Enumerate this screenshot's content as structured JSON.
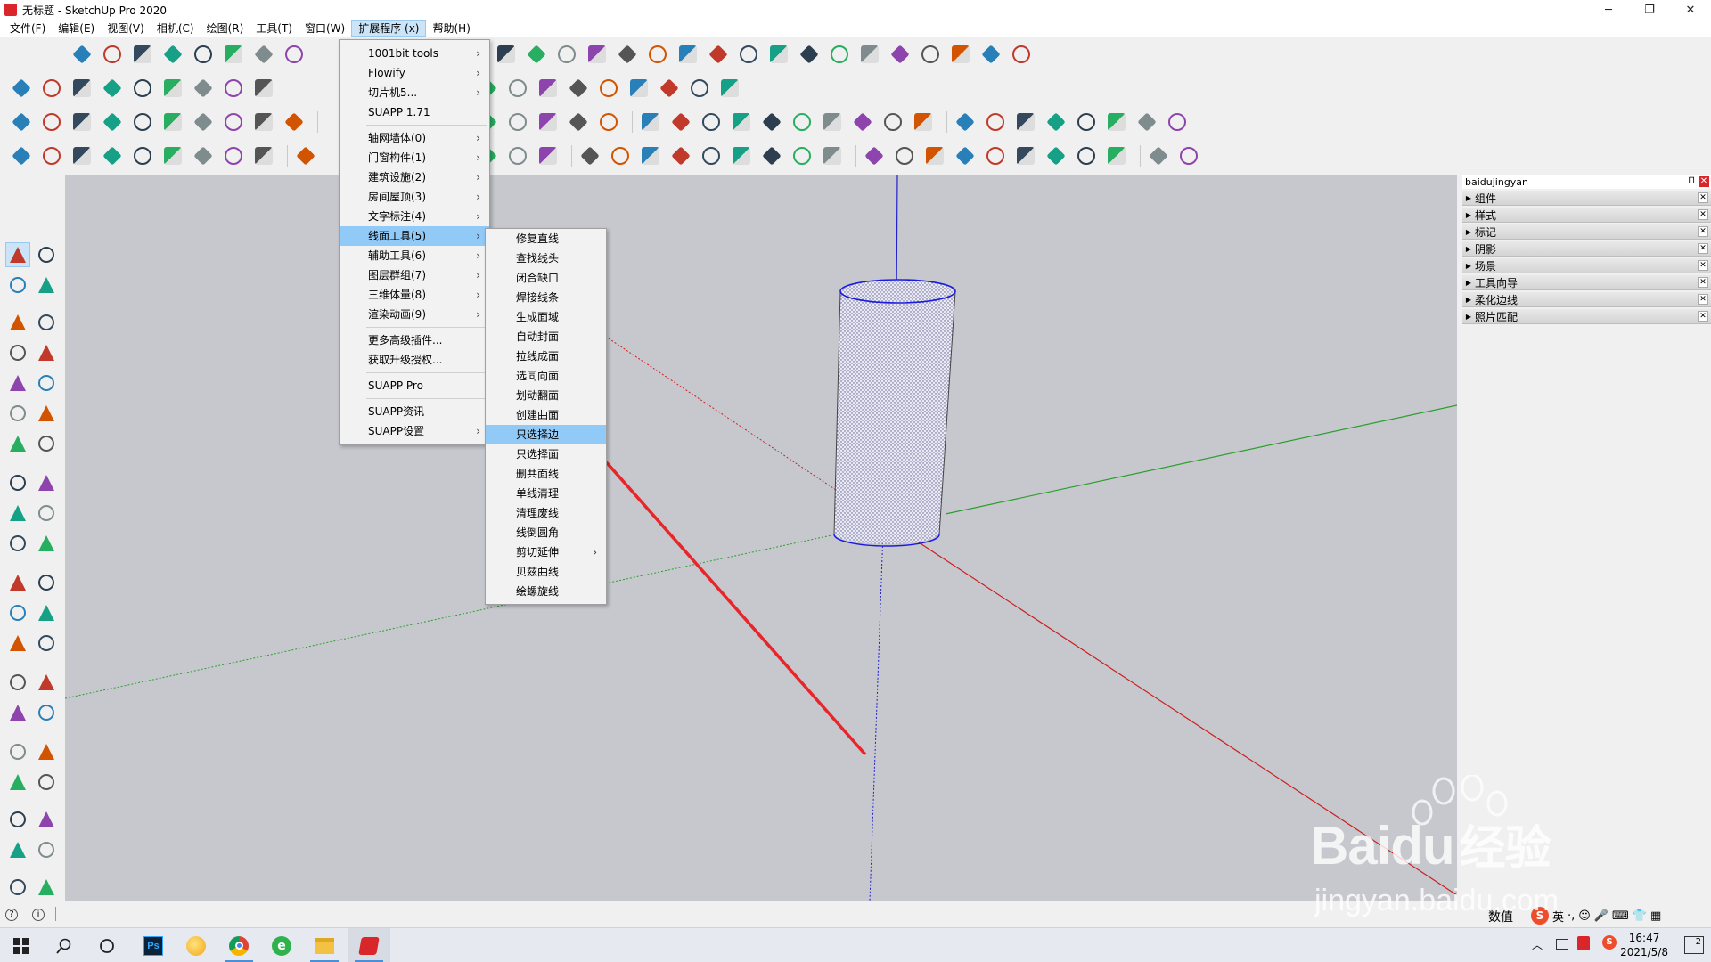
{
  "window": {
    "title": "无标题 - SketchUp Pro 2020",
    "controls": [
      "─",
      "❐",
      "✕"
    ]
  },
  "menubar": {
    "items": [
      "文件(F)",
      "编辑(E)",
      "视图(V)",
      "相机(C)",
      "绘图(R)",
      "工具(T)",
      "窗口(W)",
      "扩展程序 (x)",
      "帮助(H)"
    ],
    "active_index": 7
  },
  "extension_menu": {
    "items": [
      {
        "label": "1001bit tools",
        "submenu": true
      },
      {
        "label": "Flowify",
        "submenu": true
      },
      {
        "label": "切片机5...",
        "submenu": true
      },
      {
        "label": "SUAPP 1.71",
        "submenu": false
      },
      {
        "sep": true
      },
      {
        "label": "轴网墙体(0)",
        "submenu": true
      },
      {
        "label": "门窗构件(1)",
        "submenu": true
      },
      {
        "label": "建筑设施(2)",
        "submenu": true
      },
      {
        "label": "房间屋顶(3)",
        "submenu": true
      },
      {
        "label": "文字标注(4)",
        "submenu": true
      },
      {
        "label": "线面工具(5)",
        "submenu": true,
        "highlighted": true
      },
      {
        "label": "辅助工具(6)",
        "submenu": true
      },
      {
        "label": "图层群组(7)",
        "submenu": true
      },
      {
        "label": "三维体量(8)",
        "submenu": true
      },
      {
        "label": "渲染动画(9)",
        "submenu": true
      },
      {
        "sep": true
      },
      {
        "label": "更多高级插件...",
        "submenu": false
      },
      {
        "label": "获取升级授权...",
        "submenu": false
      },
      {
        "sep": true
      },
      {
        "label": "SUAPP Pro",
        "submenu": false
      },
      {
        "sep": true
      },
      {
        "label": "SUAPP资讯",
        "submenu": false
      },
      {
        "label": "SUAPP设置",
        "submenu": true
      }
    ]
  },
  "line_face_submenu": {
    "items": [
      {
        "label": "修复直线"
      },
      {
        "label": "查找线头"
      },
      {
        "label": "闭合缺口"
      },
      {
        "label": "焊接线条"
      },
      {
        "label": "生成面域"
      },
      {
        "label": "自动封面"
      },
      {
        "label": "拉线成面"
      },
      {
        "label": "选同向面"
      },
      {
        "label": "划动翻面"
      },
      {
        "label": "创建曲面"
      },
      {
        "label": "只选择边",
        "highlighted": true
      },
      {
        "label": "只选择面"
      },
      {
        "label": "删共面线"
      },
      {
        "label": "单线清理"
      },
      {
        "label": "清理废线"
      },
      {
        "label": "线倒圆角"
      },
      {
        "label": "剪切延伸",
        "submenu": true
      },
      {
        "label": "贝兹曲线"
      },
      {
        "label": "绘螺旋线"
      }
    ]
  },
  "tray": {
    "title": "baidujingyan",
    "panels": [
      "组件",
      "样式",
      "标记",
      "阴影",
      "场景",
      "工具向导",
      "柔化边线",
      "照片匹配"
    ]
  },
  "statusbar": {
    "value_label": "数值"
  },
  "taskbar": {
    "time": "16:47",
    "date": "2021/5/8",
    "ime": "英",
    "notification_count": "2"
  },
  "watermark": {
    "brand": "Baidu",
    "brand_cn": "经验",
    "url": "jingyan.baidu.com"
  },
  "colors": {
    "viewport_bg": "#c6c8ce",
    "menu_highlight": "#91c9f7",
    "axis_red": "#cc2020",
    "axis_green": "#2aa02a",
    "axis_blue": "#2020cc",
    "annotation_arrow": "#e8262a"
  }
}
